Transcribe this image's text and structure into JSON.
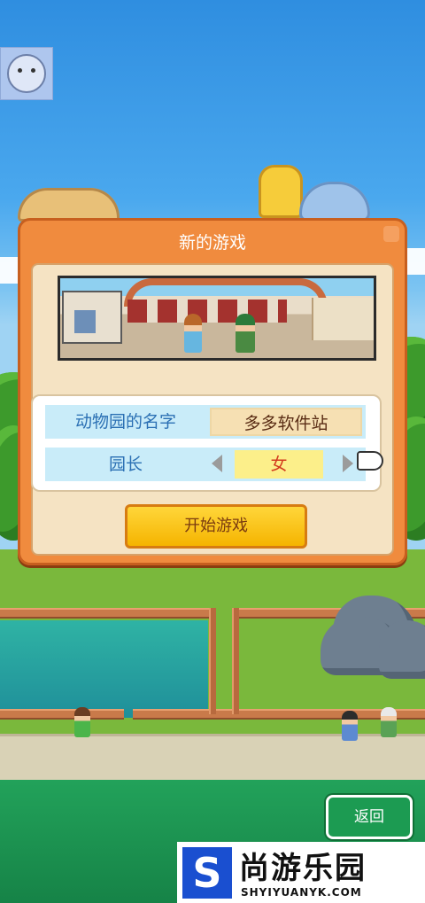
{
  "dialog": {
    "title": "新的游戏",
    "zoo_name_label": "动物园的名字",
    "zoo_name_value": "多多软件站",
    "director_label": "园长",
    "director_value": "女",
    "start_button": "开始游戏"
  },
  "footer": {
    "back_button": "返回"
  },
  "watermark": {
    "brand": "尚游乐园",
    "url": "SHYIYUANYK.COM",
    "logo_letter": "S"
  },
  "colors": {
    "panel_orange": "#f08b3e",
    "start_yellow": "#f5b400",
    "back_green": "#1c9b52",
    "label_blue": "#2b70b4"
  }
}
